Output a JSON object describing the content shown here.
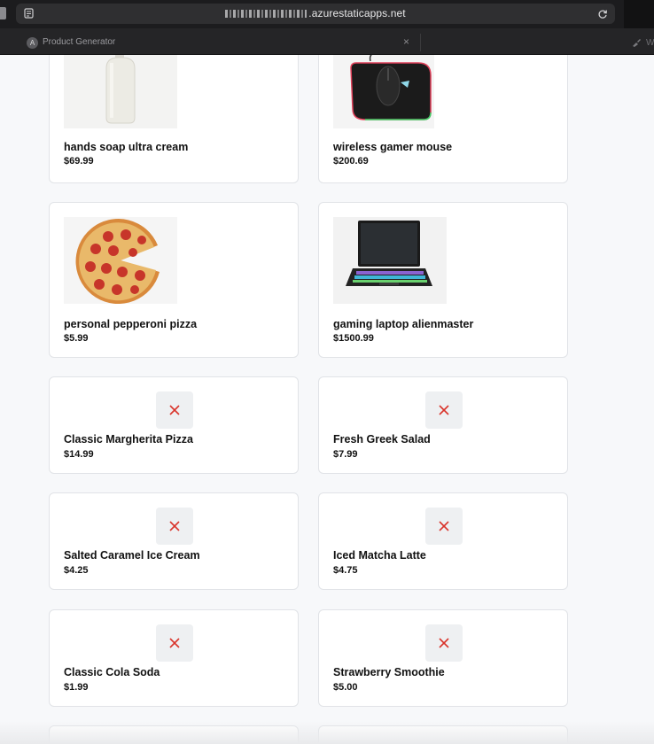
{
  "browser": {
    "url_visible": ".azurestaticapps.net",
    "tab_title": "Product Generator",
    "tab_favicon_letter": "A",
    "second_tab_label": "W"
  },
  "products": [
    {
      "name": "hands soap ultra cream",
      "price": "$69.99",
      "image": "lotion-bottle"
    },
    {
      "name": "wireless gamer mouse",
      "price": "$200.69",
      "image": "gaming-mouse"
    },
    {
      "name": "personal pepperoni pizza",
      "price": "$5.99",
      "image": "pepperoni-pizza"
    },
    {
      "name": "gaming laptop alienmaster",
      "price": "$1500.99",
      "image": "gaming-laptop"
    },
    {
      "name": "Classic Margherita Pizza",
      "price": "$14.99",
      "image": "broken-image"
    },
    {
      "name": "Fresh Greek Salad",
      "price": "$7.99",
      "image": "broken-image"
    },
    {
      "name": "Salted Caramel Ice Cream",
      "price": "$4.25",
      "image": "broken-image"
    },
    {
      "name": "Iced Matcha Latte",
      "price": "$4.75",
      "image": "broken-image"
    },
    {
      "name": "Classic Cola Soda",
      "price": "$1.99",
      "image": "broken-image"
    },
    {
      "name": "Strawberry Smoothie",
      "price": "$5.00",
      "image": "broken-image"
    }
  ],
  "colors": {
    "broken_image_x": "#d9342b",
    "page_background": "#f7f8fa",
    "card_border": "#e1e3e7"
  }
}
